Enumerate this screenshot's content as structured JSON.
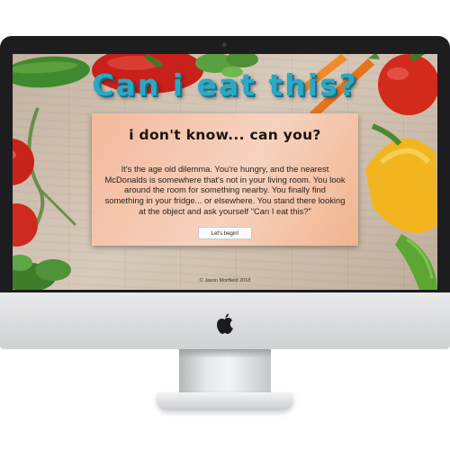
{
  "site": {
    "title": "Can i eat this?",
    "card_heading": "i don't know... can you?",
    "card_body": "It's the age old dilemma. You're hungry, and the nearest McDonalds is somewhere that's not in your living room. You look around the room for something nearby. You finally find something in your fridge... or elsewhere. You stand there looking at the object and ask yourself \"Can I eat this?\"",
    "start_button_label": "Let's begin!",
    "copyright": "© Jason Mortfield 2018"
  },
  "colors": {
    "title": "#2aa9c6",
    "card": "#f6d3bf",
    "bezel": "#1d1d1f",
    "chin": "#dcdde0"
  },
  "icons": [
    "apple-logo-icon",
    "camera-dot-icon"
  ]
}
